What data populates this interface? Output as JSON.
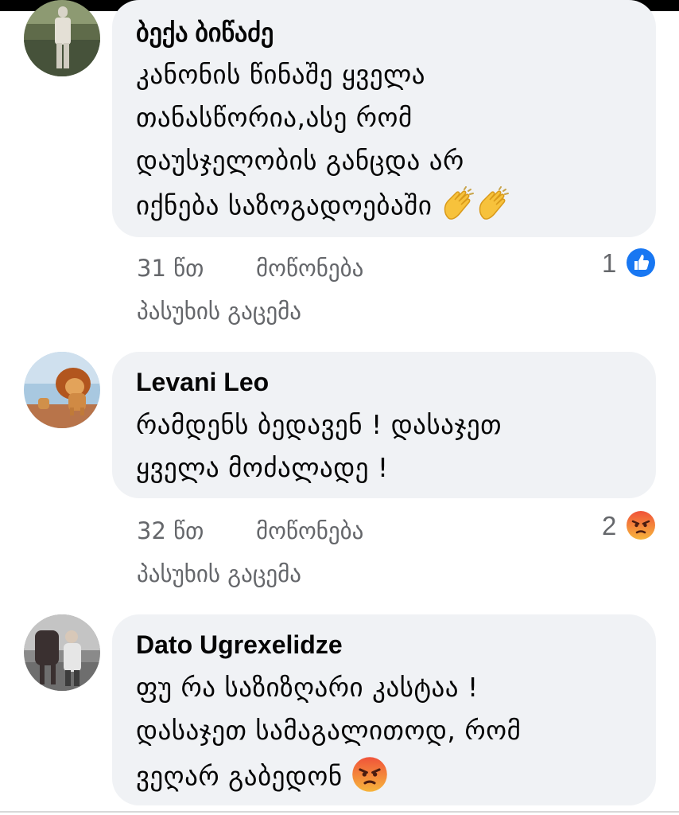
{
  "comments": [
    {
      "author": "ბექა ბიწაძე",
      "lines": [
        "კანონის წინაშე ყველა",
        "თანასწორია,ასე რომ",
        "დაუსჯელობის განცდა არ",
        "იქნება საზოგადოებაში"
      ],
      "trailing_emoji": [
        "clapping-hands",
        "clapping-hands"
      ],
      "time": "31 წთ",
      "like_label": "მოწონება",
      "reply_label": "პასუხის გაცემა",
      "reaction_count": "1",
      "reaction_icon": "like-icon"
    },
    {
      "author": "Levani Leo",
      "lines": [
        "რამდენს ბედავენ ! დასაჯეთ",
        "ყველა მოძალადე !"
      ],
      "time": "32 წთ",
      "like_label": "მოწონება",
      "reply_label": "პასუხის გაცემა",
      "reaction_count": "2",
      "reaction_icon": "angry-icon"
    },
    {
      "author": "Dato Ugrexelidze",
      "lines": [
        "ფუ რა საზიზღარი კასტაა !",
        "დასაჯეთ სამაგალითოდ,  რომ",
        "ვეღარ გაბედონ"
      ],
      "trailing_emoji": [
        "angry-face"
      ]
    }
  ],
  "colors": {
    "bubble_bg": "#f0f2f5",
    "meta_text": "#65676b",
    "like_blue": "#1877f2",
    "angry_orange": "#f0533a"
  }
}
